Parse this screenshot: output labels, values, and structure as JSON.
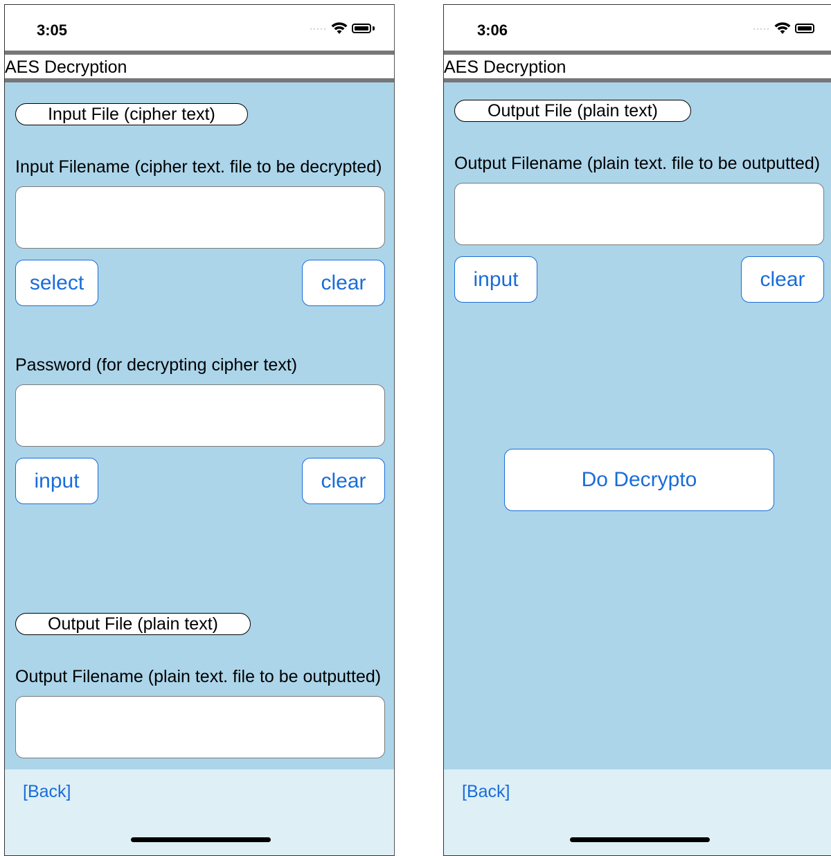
{
  "left": {
    "time": "3:05",
    "title": "AES Decryption",
    "input_file_pill": "Input File (cipher text)",
    "input_filename_label": "Input Filename (cipher text. file to be decrypted)",
    "select_label": "select",
    "clear_label": "clear",
    "password_label": "Password (for decrypting cipher text)",
    "input_label": "input",
    "clear2_label": "clear",
    "output_file_pill": "Output File (plain text)",
    "output_filename_label": "Output Filename (plain text. file to be outputted)",
    "back_label": "[Back]"
  },
  "right": {
    "time": "3:06",
    "title": "AES Decryption",
    "output_file_pill": "Output File (plain text)",
    "output_filename_label": "Output Filename (plain text. file to be outputted)",
    "input_label": "input",
    "clear_label": "clear",
    "do_decrypto_label": "Do Decrypto",
    "back_label": "[Back]"
  },
  "colors": {
    "content_bg": "#acd5ea",
    "footer_bg": "#def0f6",
    "accent": "#1a6cd8",
    "divider": "#777777"
  },
  "icons": [
    "signal-dots-icon",
    "wifi-icon",
    "battery-icon"
  ]
}
